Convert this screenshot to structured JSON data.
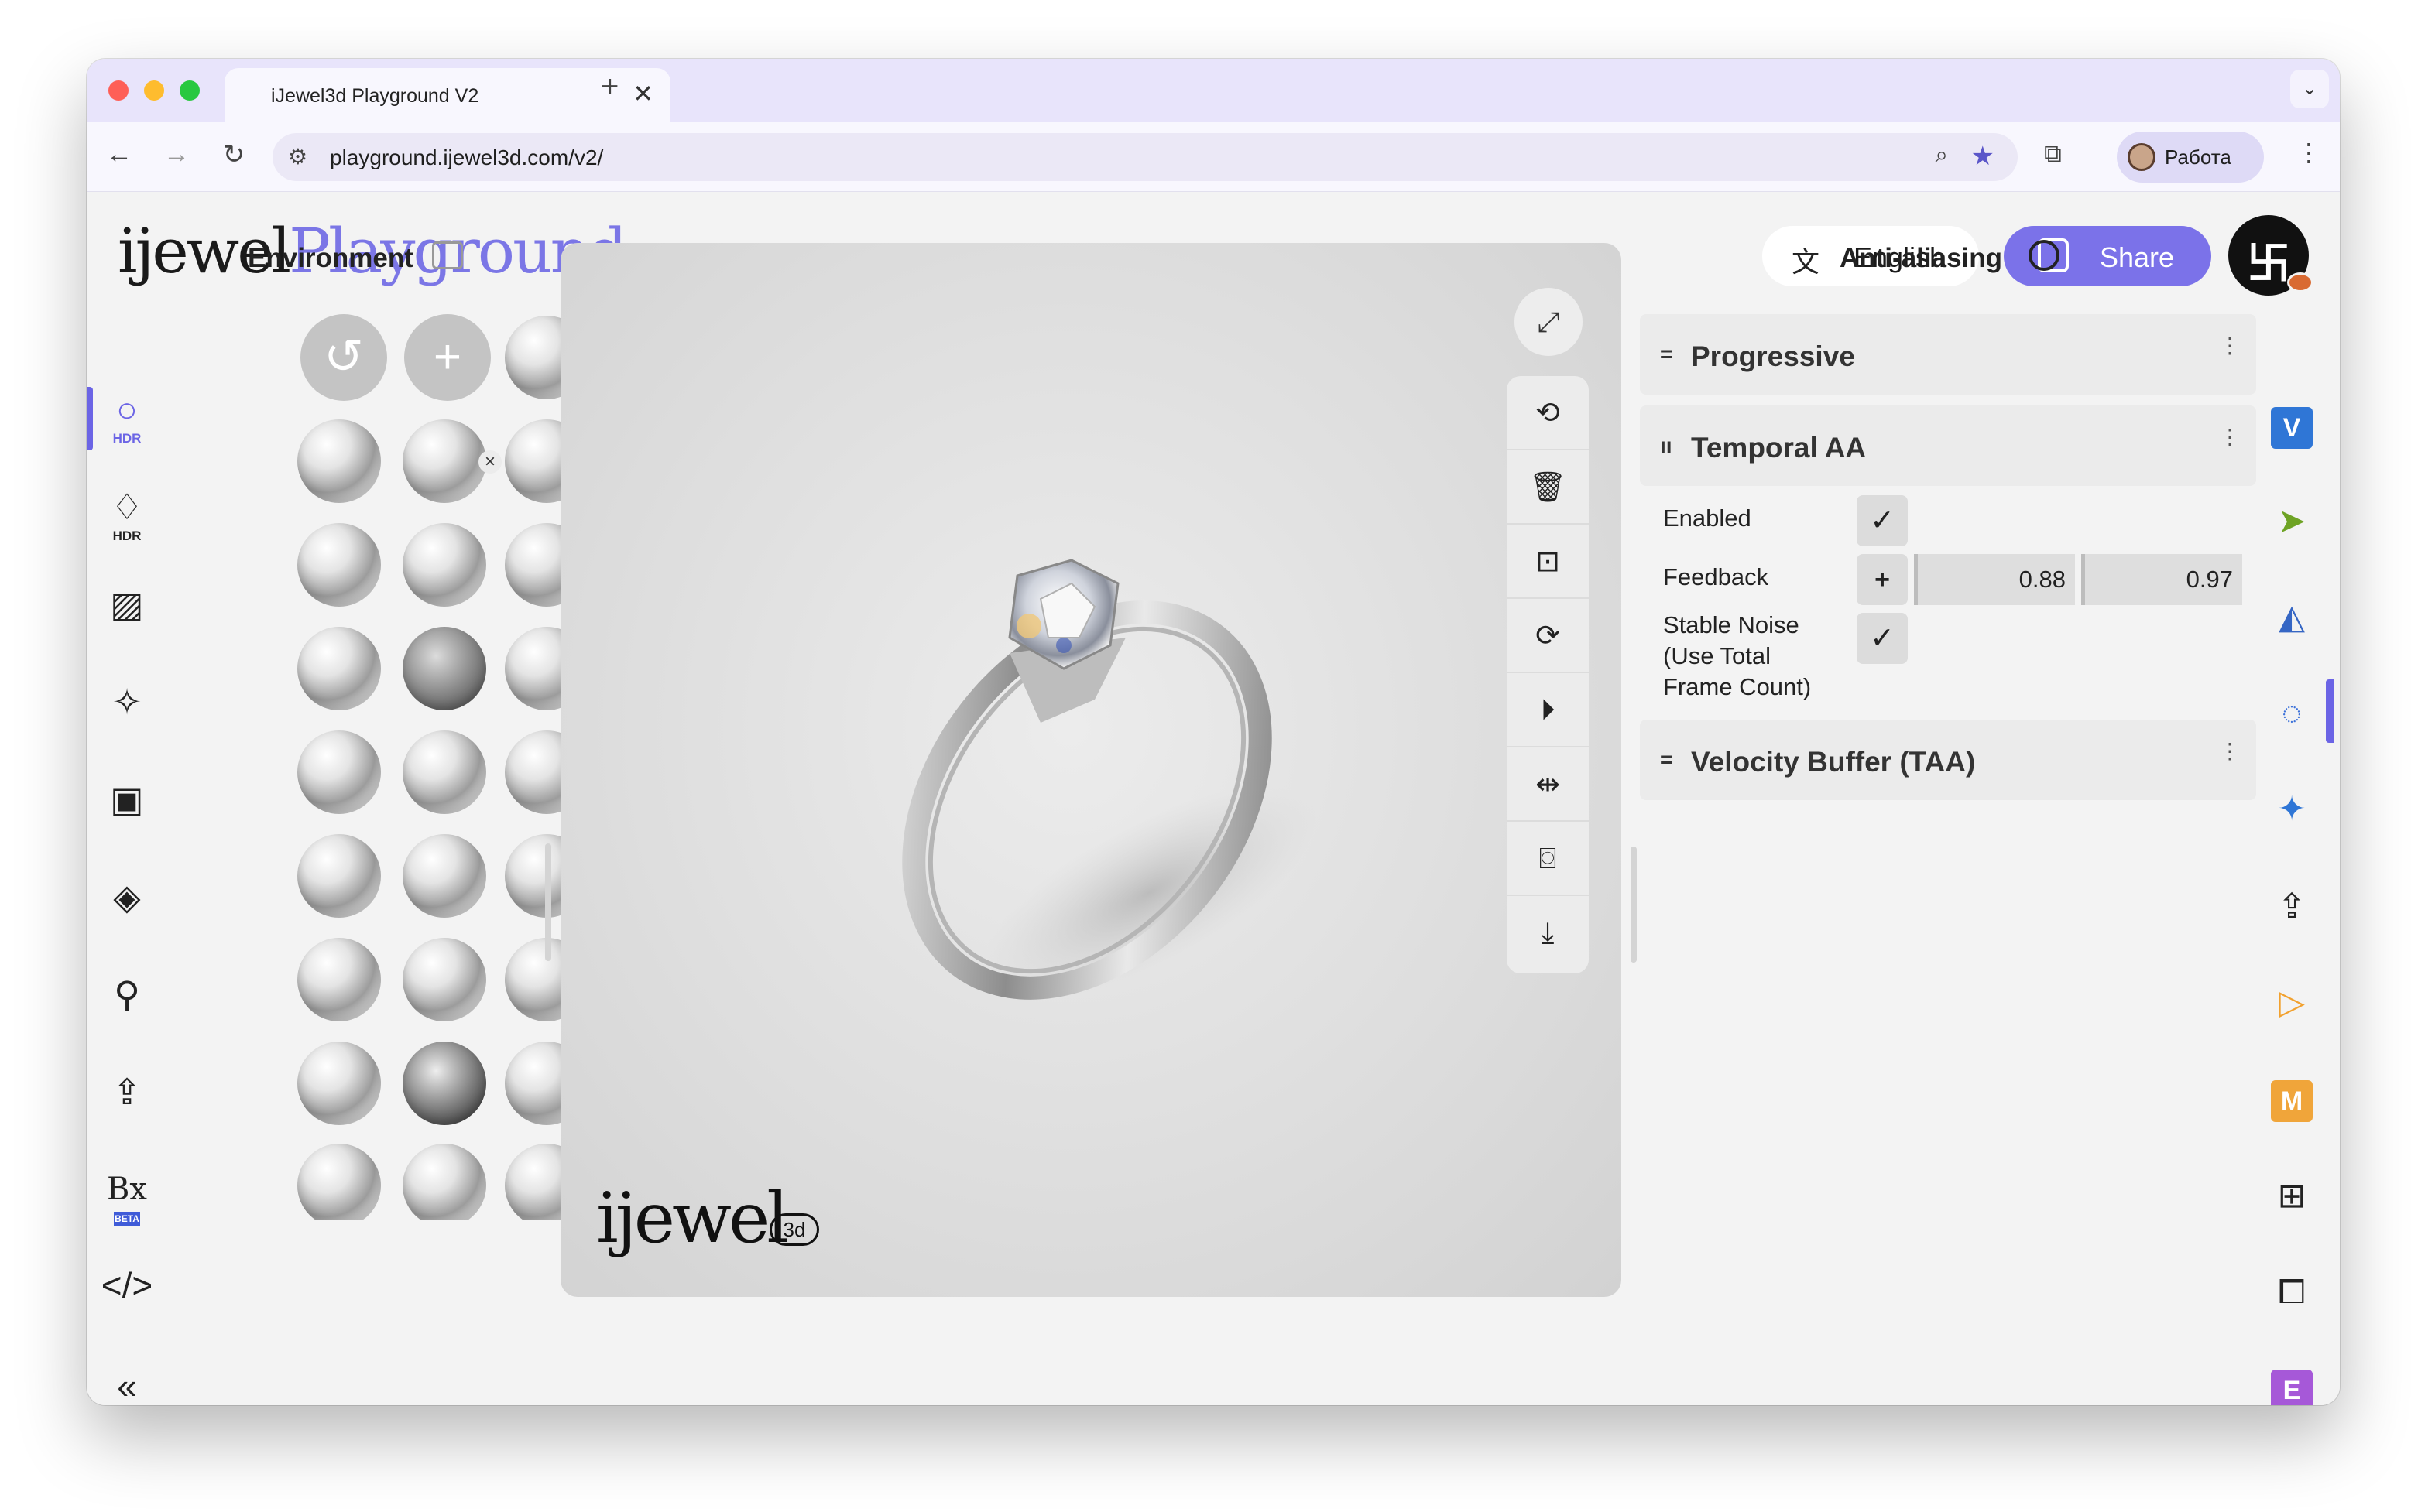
{
  "browser": {
    "tab_title": "iJewel3d Playground V2",
    "tab_close": "✕",
    "new_tab": "+",
    "tabs_menu": "⌄",
    "url": "playground.ijewel3d.com/v2/",
    "profile_name": "Работа",
    "icons": [
      "back-arrow-icon",
      "forward-arrow-icon",
      "reload-icon",
      "site-settings-icon",
      "zoom-icon",
      "bookmark-star-icon",
      "extensions-icon",
      "kebab-menu-icon"
    ]
  },
  "header": {
    "logo_part1": "ijewel",
    "logo_part2": "Playground",
    "language_label": "English",
    "share_label": "Share",
    "accent_color": "#7b72e9"
  },
  "left_rail": {
    "items": [
      {
        "icon": "hdr-ring-icon",
        "sub": "HDR"
      },
      {
        "icon": "hdr-diamond-icon",
        "sub": "HDR"
      },
      {
        "icon": "hatch-pattern-icon",
        "sub": ""
      },
      {
        "icon": "sparkle-icon",
        "sub": ""
      },
      {
        "icon": "image-frame-icon",
        "sub": ""
      },
      {
        "icon": "plane-icon",
        "sub": ""
      },
      {
        "icon": "ring-icon",
        "sub": ""
      },
      {
        "icon": "upload-box-icon",
        "sub": ""
      },
      {
        "icon": "bx-beta-icon",
        "sub": "BETA"
      },
      {
        "icon": "code-icon",
        "sub": ""
      },
      {
        "icon": "collapse-chevrons-icon",
        "sub": ""
      }
    ]
  },
  "environment": {
    "title": "Environment",
    "reset_glyph": "↺",
    "add_glyph": "+",
    "remove_glyph": "×"
  },
  "viewport": {
    "watermark": "ijewel",
    "watermark_badge": "3d",
    "tools": [
      "fullscreen-icon",
      "rotate-icon",
      "trash-icon",
      "focus-icon",
      "sync-icon",
      "play-icon",
      "pivot-icon",
      "camera-icon",
      "download-icon"
    ]
  },
  "settings": {
    "title": "Anti-aliasing",
    "sections": [
      {
        "grip": "=",
        "title": "Progressive",
        "more": "⋮"
      },
      {
        "grip": "ıı",
        "title": "Temporal AA",
        "more": "⋮"
      },
      {
        "grip": "=",
        "title": "Velocity Buffer (TAA)",
        "more": "⋮"
      }
    ],
    "enabled_label": "Enabled",
    "feedback_label": "Feedback",
    "feedback_values": [
      "0.88",
      "0.97"
    ],
    "stable_noise_label_1": "Stable Noise",
    "stable_noise_label_2": "(Use Total",
    "stable_noise_label_3": "Frame Count)",
    "check_glyph": "✓",
    "plus_glyph": "+"
  },
  "right_rail": {
    "items": [
      {
        "icon": "v-badge-icon",
        "letter": "V",
        "color": "#2f76d6"
      },
      {
        "icon": "cursor-arrow-icon",
        "letter": "",
        "color": "#6ea324"
      },
      {
        "icon": "shapes-icon",
        "letter": "",
        "color": "#3566c4"
      },
      {
        "icon": "loader-ring-icon",
        "letter": "",
        "color": "#3d72d9"
      },
      {
        "icon": "sparkle-icon",
        "letter": "",
        "color": "#2f76d6"
      },
      {
        "icon": "upload-box-icon",
        "letter": "",
        "color": "#222222"
      },
      {
        "icon": "play-triangle-icon",
        "letter": "",
        "color": "#f2a12e"
      },
      {
        "icon": "m-badge-icon",
        "letter": "M",
        "color": "#f0a53a"
      },
      {
        "icon": "grid-icon",
        "letter": "",
        "color": "#222222"
      },
      {
        "icon": "puzzle-icon",
        "letter": "",
        "color": "#222222"
      },
      {
        "icon": "e-badge-icon",
        "letter": "E",
        "color": "#a658d8"
      }
    ]
  }
}
